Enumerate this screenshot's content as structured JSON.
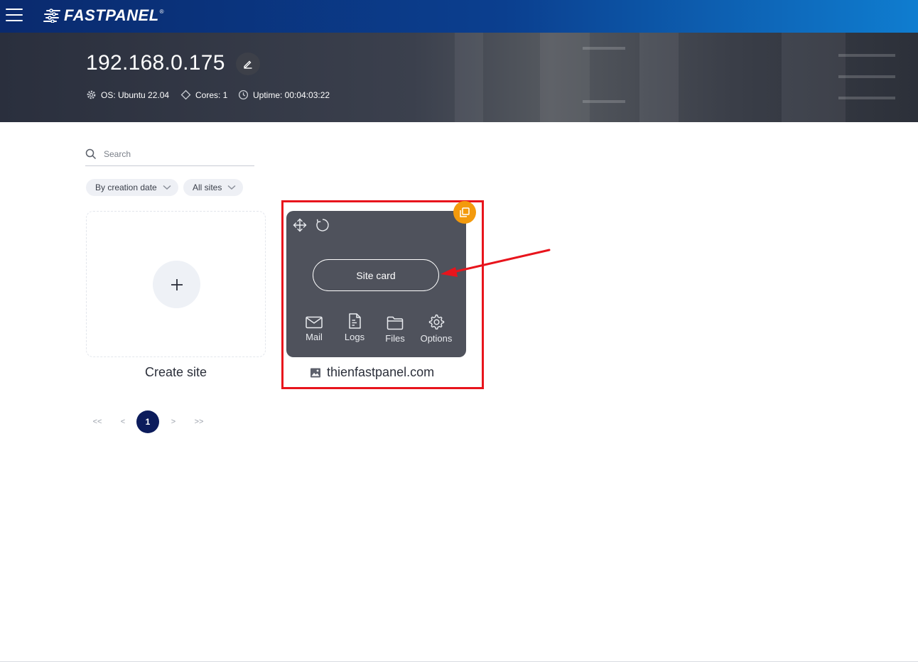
{
  "topbar": {
    "brand": "FASTPANEL",
    "brand_mark": "®",
    "menu_icon": "hamburger-icon"
  },
  "server": {
    "host": "192.168.0.175",
    "os": "OS: Ubuntu 22.04",
    "cores": "Cores: 1",
    "uptime": "Uptime: 00:04:03:22"
  },
  "search": {
    "placeholder": "Search"
  },
  "filters": {
    "sort": "By creation date",
    "scope": "All sites"
  },
  "create_card": {
    "label": "Create site"
  },
  "site_card": {
    "button_label": "Site card",
    "domain": "thienfastpanel.com",
    "actions": [
      {
        "label": "Mail",
        "icon": "mail-icon"
      },
      {
        "label": "Logs",
        "icon": "document-icon"
      },
      {
        "label": "Files",
        "icon": "folder-icon"
      },
      {
        "label": "Options",
        "icon": "gear-icon"
      }
    ]
  },
  "pagination": {
    "first": "<<",
    "prev": "<",
    "current": "1",
    "next": ">",
    "last": ">>"
  },
  "colors": {
    "accent": "#0c1c5c",
    "badge": "#f39a0d",
    "annotation": "#e8141c"
  }
}
